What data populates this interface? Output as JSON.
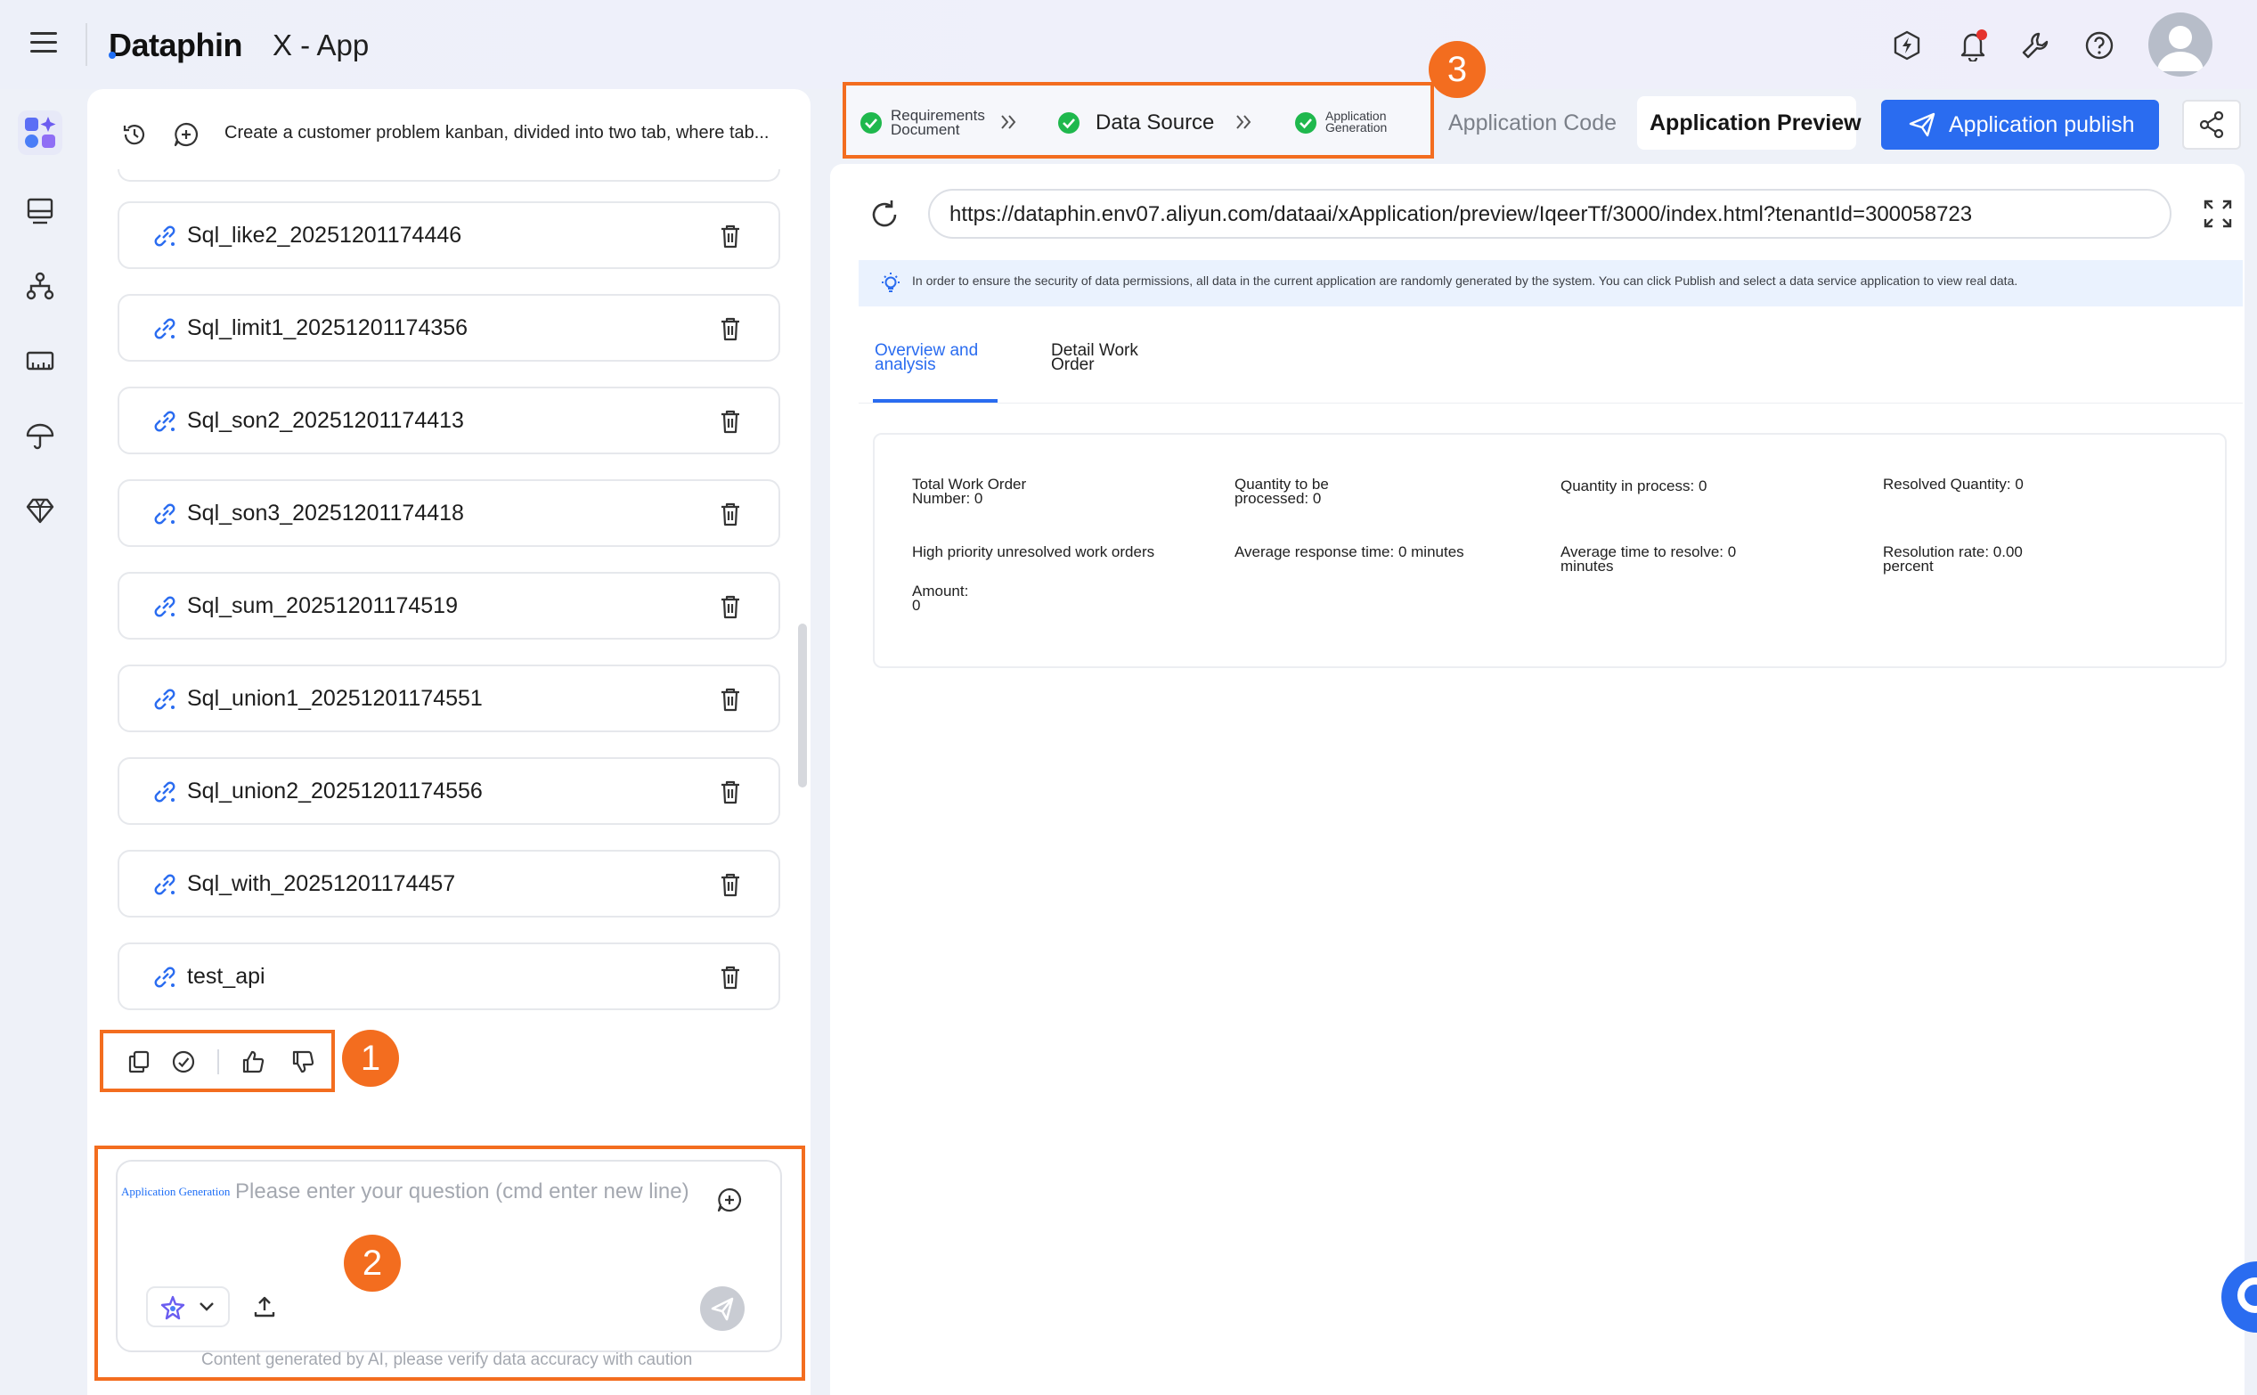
{
  "header": {
    "brand": "Dataphin",
    "app_title": "X - App",
    "icons": [
      "lightning-icon",
      "bell-icon",
      "wrench-icon",
      "help-icon"
    ],
    "notification_dot_color": "#e5322d"
  },
  "rail": {
    "icons": [
      "ai-app-icon",
      "monitor-icon",
      "org-tree-icon",
      "ruler-icon",
      "umbrella-icon",
      "diamond-icon"
    ]
  },
  "chat": {
    "prompt_preview": "Create a customer problem kanban, divided into two tab, where tab...",
    "items": [
      {
        "label": "Sql_like2_20251201174446"
      },
      {
        "label": "Sql_limit1_20251201174356"
      },
      {
        "label": "Sql_son2_20251201174413"
      },
      {
        "label": "Sql_son3_20251201174418"
      },
      {
        "label": "Sql_sum_20251201174519"
      },
      {
        "label": "Sql_union1_20251201174551"
      },
      {
        "label": "Sql_union2_20251201174556"
      },
      {
        "label": "Sql_with_20251201174457"
      },
      {
        "label": "test_api"
      }
    ],
    "input": {
      "mode_tag": "Application Generation",
      "placeholder": "Please enter your question (cmd enter new line)",
      "disclaimer": "Content generated by AI, please verify data accuracy with caution"
    }
  },
  "callouts": {
    "one": "1",
    "two": "2",
    "three": "3",
    "color": "#f36d1f"
  },
  "steps": {
    "step1": "Requirements Document",
    "step2": "Data Source",
    "step3": "Application Generation"
  },
  "toolbar": {
    "code_tab": "Application Code",
    "preview_tab": "Application Preview",
    "publish_label": "Application publish",
    "accent": "#2a6cf0"
  },
  "preview": {
    "url": "https://dataphin.env07.aliyun.com/dataai/xApplication/preview/IqeerTf/3000/index.html?tenantId=300058723",
    "notice": "In order to ensure the security of data permissions, all data in the current application are randomly generated by the system. You can click Publish and select a data service application to view real data.",
    "tabs": [
      "Overview and\nanalysis",
      "Detail Work\nOrder"
    ],
    "metrics": [
      "Total Work Order\nNumber: 0",
      "Quantity to be\nprocessed: 0",
      "Quantity in process: 0",
      "Resolved Quantity: 0",
      "High priority unresolved work orders",
      "Average response time: 0 minutes",
      "Average time to resolve: 0\nminutes",
      "Resolution rate: 0.00\npercent",
      "Amount:\n0"
    ]
  }
}
